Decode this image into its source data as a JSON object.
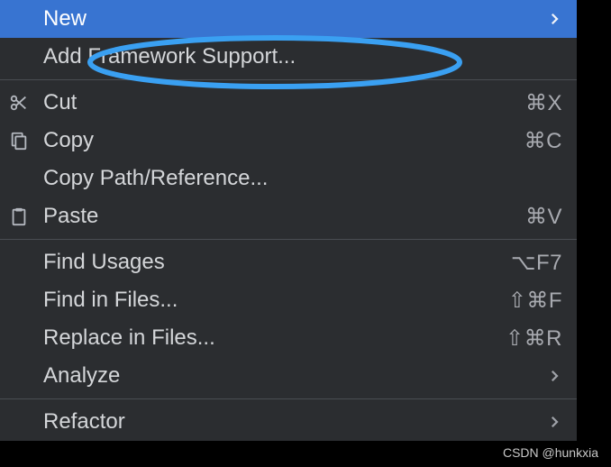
{
  "menu": {
    "items": [
      {
        "label": "New",
        "hasSubmenu": true,
        "selected": true
      },
      {
        "label": "Add Framework Support..."
      }
    ],
    "items2": [
      {
        "label": "Cut",
        "shortcut": "⌘X",
        "icon": "cut"
      },
      {
        "label": "Copy",
        "shortcut": "⌘C",
        "icon": "copy"
      },
      {
        "label": "Copy Path/Reference..."
      },
      {
        "label": "Paste",
        "shortcut": "⌘V",
        "icon": "paste"
      }
    ],
    "items3": [
      {
        "label": "Find Usages",
        "shortcut": "⌥F7"
      },
      {
        "label": "Find in Files...",
        "shortcut": "⇧⌘F"
      },
      {
        "label": "Replace in Files...",
        "shortcut": "⇧⌘R"
      },
      {
        "label": "Analyze",
        "hasSubmenu": true
      }
    ],
    "items4": [
      {
        "label": "Refactor",
        "hasSubmenu": true
      }
    ]
  },
  "watermark": "CSDN @hunkxia"
}
